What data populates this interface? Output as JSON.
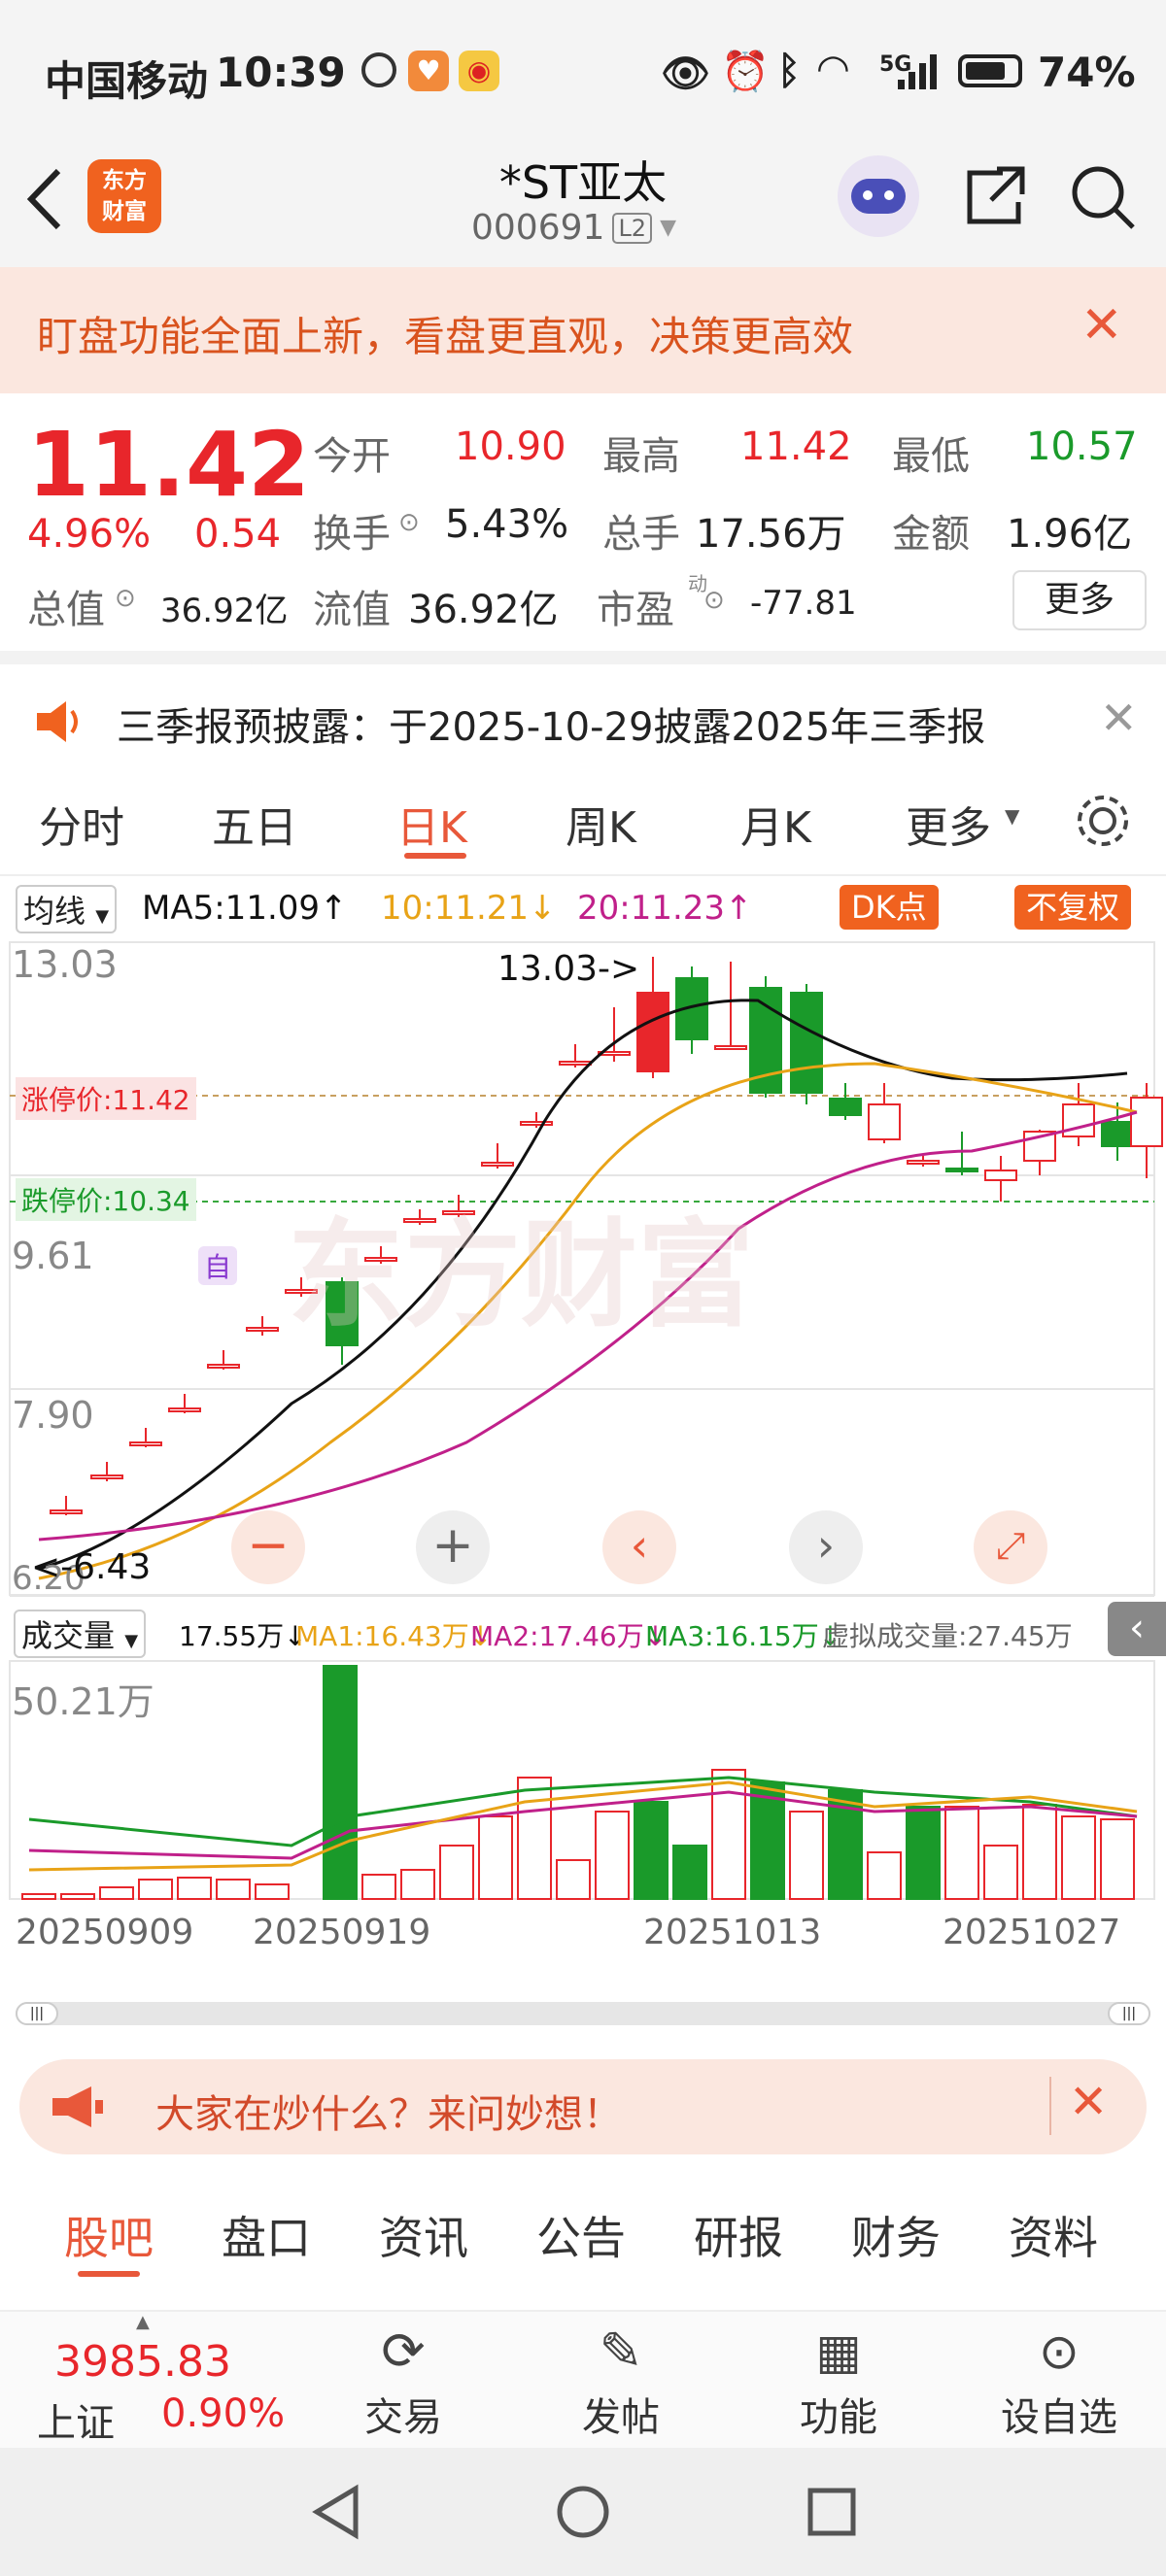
{
  "status": {
    "carrier": "中国移动",
    "time": "10:39",
    "network": "5G",
    "battery": "74%"
  },
  "header": {
    "logo_line1": "东方",
    "logo_line2": "财富",
    "title": "*ST亚太",
    "code": "000691",
    "level": "L2"
  },
  "banner": {
    "text": "盯盘功能全面上新，看盘更直观，决策更高效"
  },
  "quote": {
    "price": "11.42",
    "change_pct": "4.96%",
    "change_amt": "0.54",
    "open_label": "今开",
    "open": "10.90",
    "high_label": "最高",
    "high": "11.42",
    "low_label": "最低",
    "low": "10.57",
    "turnover_label": "换手",
    "turnover": "5.43%",
    "volume_label": "总手",
    "volume": "17.56万",
    "amount_label": "金额",
    "amount": "1.96亿",
    "mktcap_label": "总值",
    "mktcap": "36.92亿",
    "float_label": "流值",
    "float": "36.92亿",
    "pe_label": "市盈",
    "pe_sup": "动",
    "pe": "-77.81",
    "more": "更多"
  },
  "notice": {
    "text": "三季报预披露：于2025-10-29披露2025年三季报"
  },
  "tabs": [
    "分时",
    "五日",
    "日K",
    "周K",
    "月K",
    "更多"
  ],
  "active_tab": "日K",
  "ma_bar": {
    "selector": "均线",
    "ma5": "MA5:11.09↑",
    "ma10": "10:11.21↓",
    "ma20": "20:11.23↑",
    "dk": "DK点",
    "fq": "不复权"
  },
  "chart_data": {
    "type": "candlestick",
    "price_ticks": [
      "13.03",
      "9.61",
      "7.90",
      "6.20"
    ],
    "limit_up_label": "涨停价:11.42",
    "limit_down_label": "跌停价:10.34",
    "high_marker": "13.03->",
    "low_marker": "<-6.43",
    "volume_label": "成交量",
    "vol_value": "17.55万↓",
    "vol_ma1": "MA1:16.43万↓",
    "vol_ma2": "MA2:17.46万↓",
    "vol_ma3": "MA3:16.15万↓",
    "vol_virtual": "虚拟成交量:27.45万",
    "vol_max": "50.21万",
    "dates": [
      "20250909",
      "20250919",
      "20251013",
      "20251027"
    ],
    "watermark": "东方财富",
    "auto_marker": "自"
  },
  "ask": {
    "text": "大家在炒什么？来问妙想！"
  },
  "bottom_tabs": [
    "股吧",
    "盘口",
    "资讯",
    "公告",
    "研报",
    "财务",
    "资料"
  ],
  "toolbar": {
    "index_value": "3985.83",
    "index_name": "上证",
    "index_pct": "0.90%",
    "trade": "交易",
    "post": "发帖",
    "func": "功能",
    "watch": "设自选"
  }
}
